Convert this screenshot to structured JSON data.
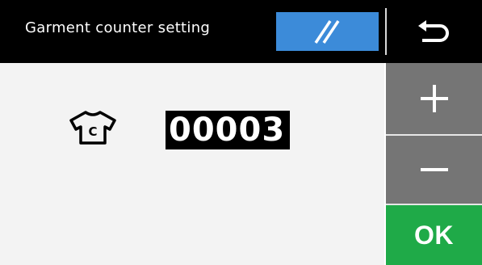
{
  "header": {
    "title": "Garment counter setting",
    "stripe_button_icon": "double-slash-icon",
    "back_button_icon": "return-arrow-icon"
  },
  "counter": {
    "icon": "tshirt-c-icon",
    "icon_letter": "C",
    "value": "00003"
  },
  "side_buttons": {
    "plus_icon": "plus-icon",
    "minus_icon": "minus-icon",
    "ok_label": "OK"
  },
  "colors": {
    "header_bg": "#000000",
    "accent_blue": "#3c8bd9",
    "gray_button": "#757575",
    "ok_green": "#1faa48",
    "panel_bg": "#f3f3f3"
  }
}
